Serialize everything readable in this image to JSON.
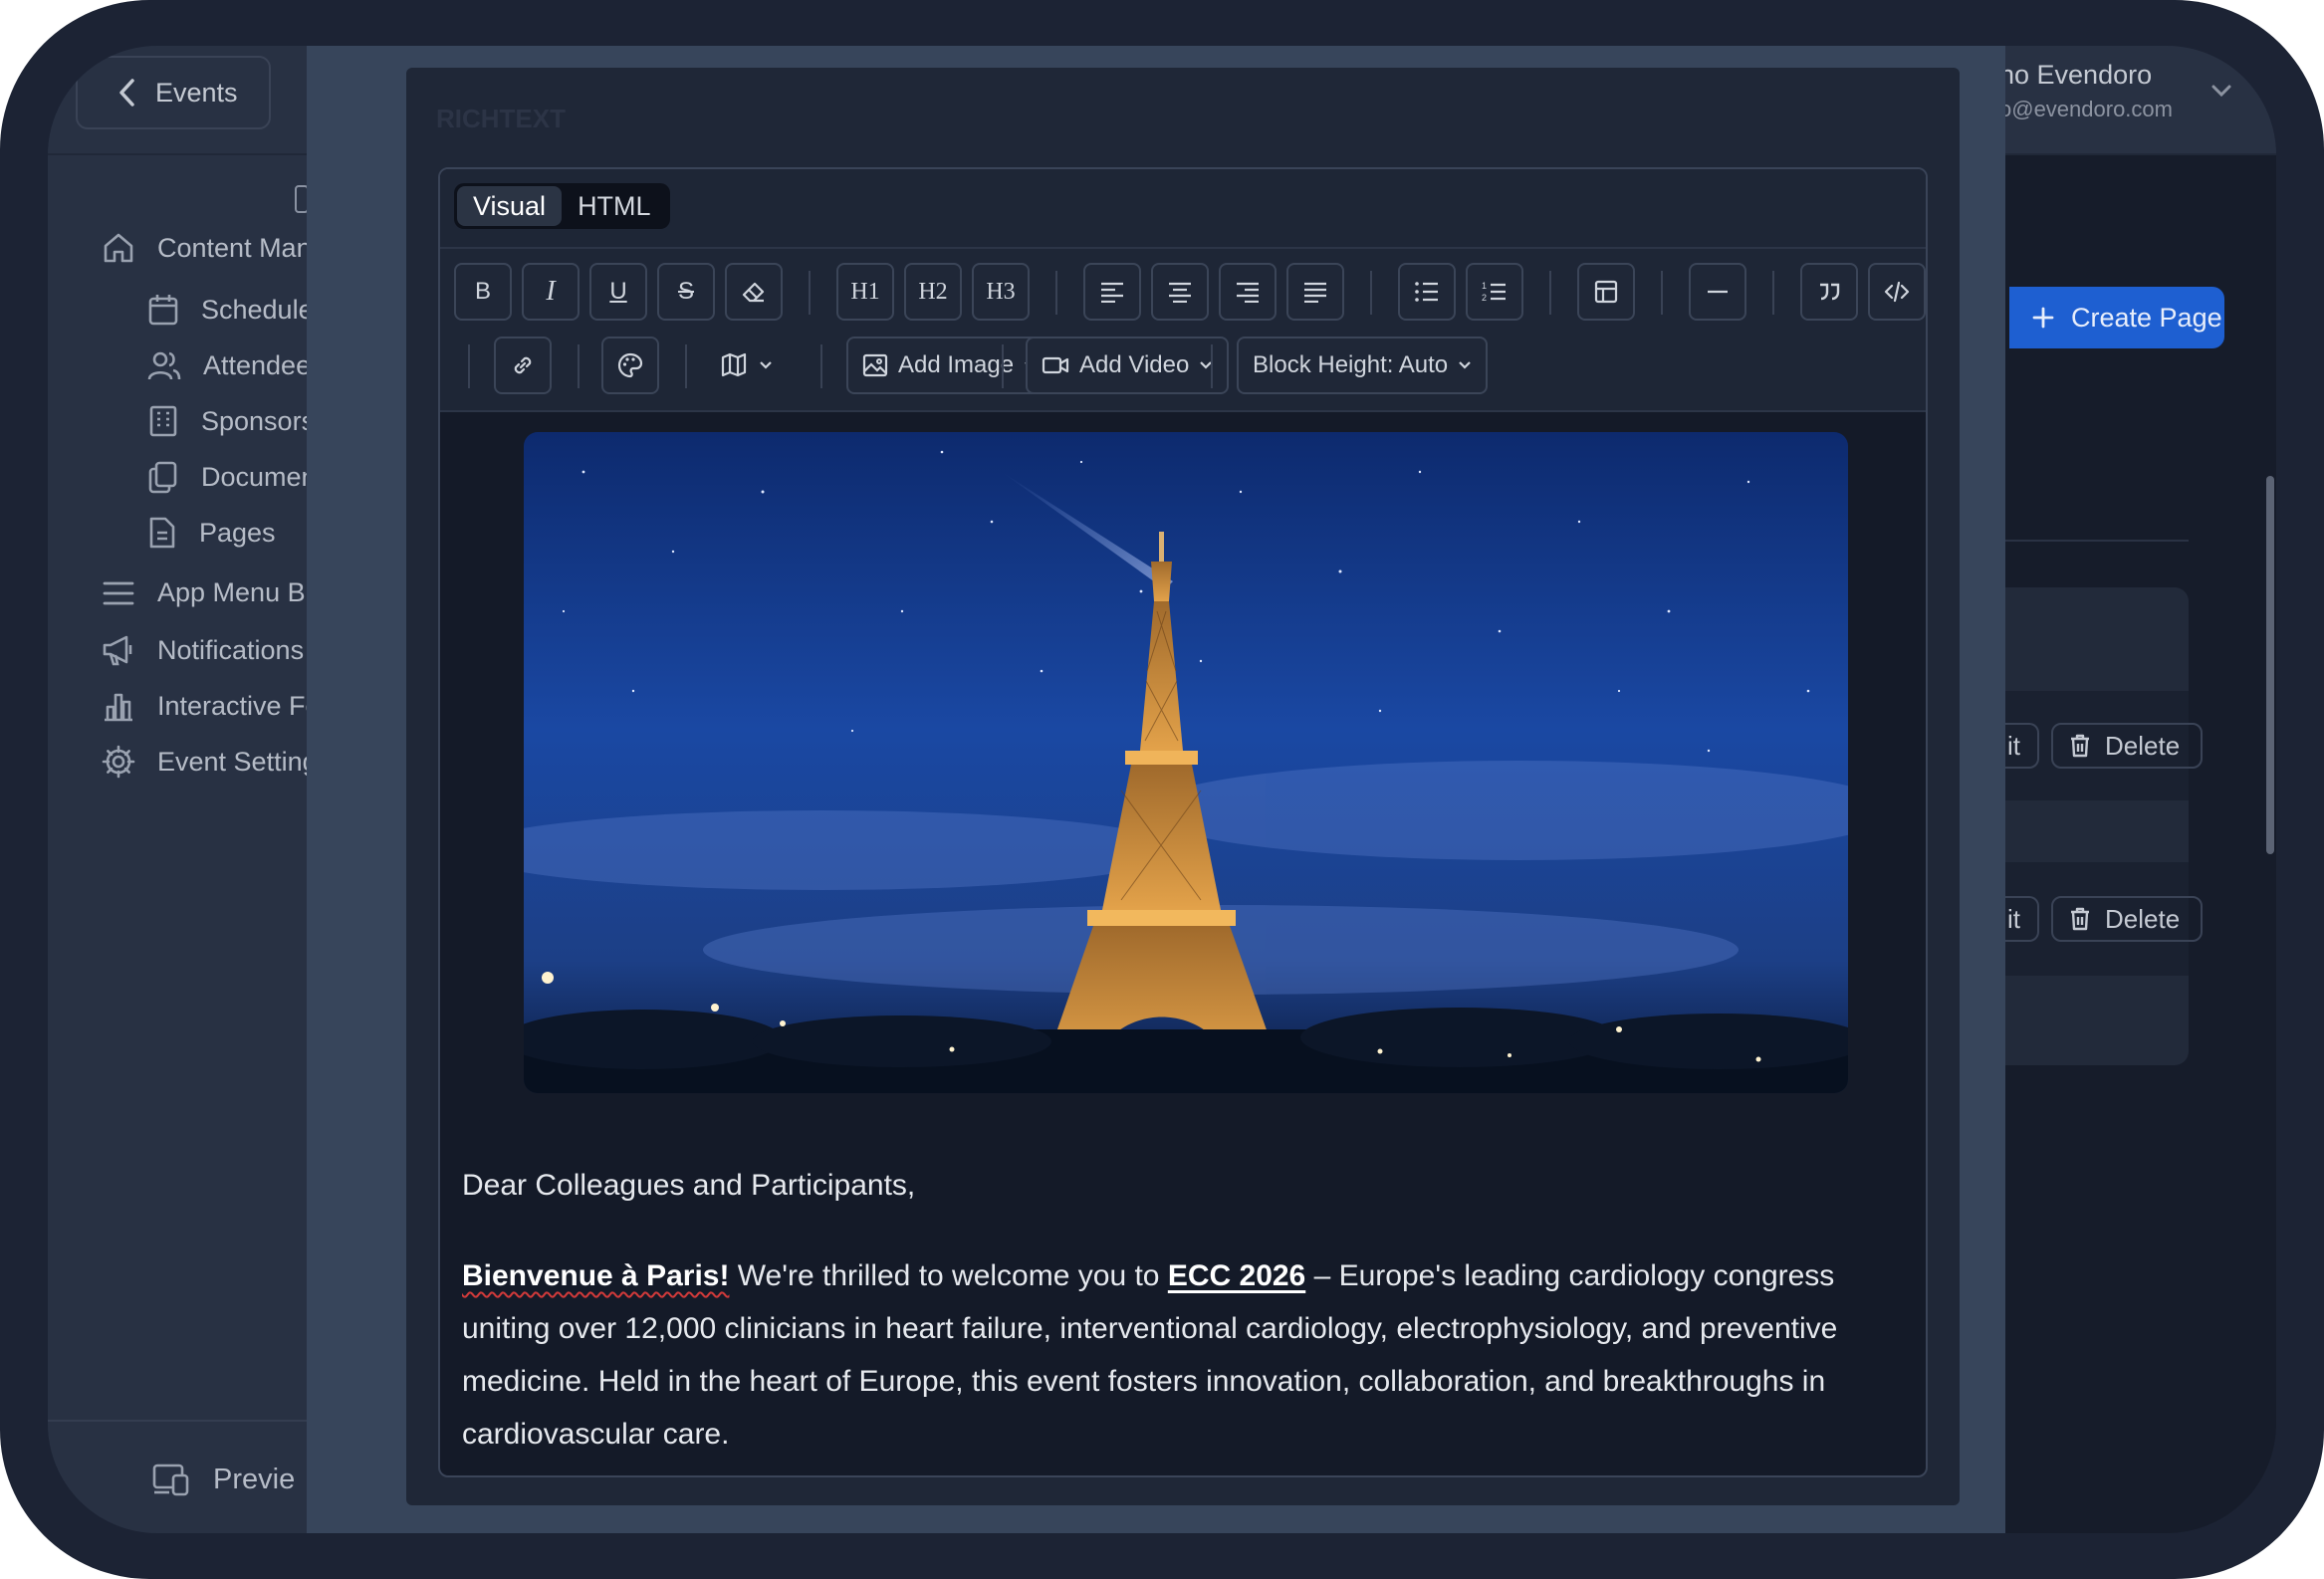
{
  "topbar": {
    "back_label": "Events",
    "user_name": "no Evendoro",
    "user_email": "o@evendoro.com"
  },
  "sidebar": {
    "items": [
      {
        "label": "Content Man",
        "icon": "home-icon"
      },
      {
        "label": "Schedule",
        "icon": "calendar-icon"
      },
      {
        "label": "Attendee",
        "icon": "users-icon"
      },
      {
        "label": "Sponsors",
        "icon": "building-icon"
      },
      {
        "label": "Documen",
        "icon": "documents-icon"
      },
      {
        "label": "Pages",
        "icon": "page-icon"
      },
      {
        "label": "App Menu Bu",
        "icon": "menu-icon"
      },
      {
        "label": "Notifications",
        "icon": "megaphone-icon"
      },
      {
        "label": "Interactive Fe",
        "icon": "bar-chart-icon"
      },
      {
        "label": "Event Setting",
        "icon": "gear-icon"
      }
    ],
    "preview_label": "Previe"
  },
  "right_panel": {
    "create_page_label": "Create Page",
    "rows": [
      {
        "edit_label": "it",
        "delete_label": "Delete"
      },
      {
        "edit_label": "it",
        "delete_label": "Delete"
      }
    ]
  },
  "modal": {
    "header_title": "RICHTEXT",
    "mode_tabs": [
      "Visual",
      "HTML"
    ],
    "active_mode": "Visual",
    "toolbar": {
      "bold": "B",
      "italic": "I",
      "underline": "U",
      "strike": "S",
      "h1": "H1",
      "h2": "H2",
      "h3": "H3",
      "add_image": "Add Image",
      "add_video": "Add Video",
      "block_height": "Block Height: Auto"
    },
    "content": {
      "image_alt": "Eiffel Tower at night under a starry blue sky with a crescent moon",
      "greeting": "Dear Colleagues and Participants,",
      "bold_intro": "Bienvenue à Paris!",
      "text_before_link": " We're thrilled to welcome you to ",
      "link_text": "ECC 2026",
      "text_after_link": " – Europe's leading cardiology congress uniting over 12,000 clinicians in heart failure, interventional cardiology, electrophysiology, and preventive medicine. Held in the heart of Europe, this event fosters innovation, collaboration, and breakthroughs in cardiovascular care."
    }
  },
  "colors": {
    "accent": "#1e5fd1",
    "editor_bg": "#141a28",
    "overlay": "#37455b"
  }
}
